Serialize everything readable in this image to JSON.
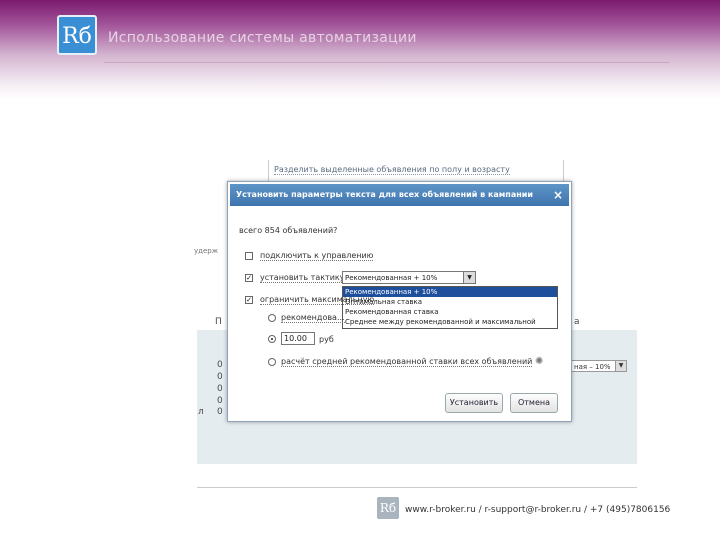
{
  "header": {
    "logo_text": "Rб",
    "title": "Использование системы автоматизации"
  },
  "background": {
    "split_link": "Разделить выделенные объявления по полу и возрасту",
    "frag_left": "удерж",
    "frag_p": "П",
    "frag_a": "а",
    "frag_l": "л",
    "digits": [
      "0",
      "0",
      "0",
      "0",
      "0"
    ],
    "select_value": "ная – 10%"
  },
  "dialog": {
    "title": "Установить параметры текста для всех объявлений в кампании",
    "close": "×",
    "count_text": "всего 854 объявлений?",
    "option_budget": "подключить к управлению",
    "option_strategy": "установить тактику",
    "strategy_value": "Рекомендованная + 10%",
    "dropdown_options": [
      "Рекомендованная + 10%",
      "Оптимальная ставка",
      "Рекомендованная ставка",
      "Среднее между рекомендованной и максимальной"
    ],
    "option_max": "ограничить максимальную",
    "radio_recommended": "рекомендова...",
    "bid_value": "10.00",
    "bid_unit": "руб",
    "radio_average": "расчёт средней рекомендованной ставки всех объявлений",
    "button_set": "Установить",
    "button_cancel": "Отмена"
  },
  "footer": {
    "logo_text": "Rб",
    "contacts": "www.r-broker.ru / r-support@r-broker.ru / +7 (495)7806156"
  }
}
